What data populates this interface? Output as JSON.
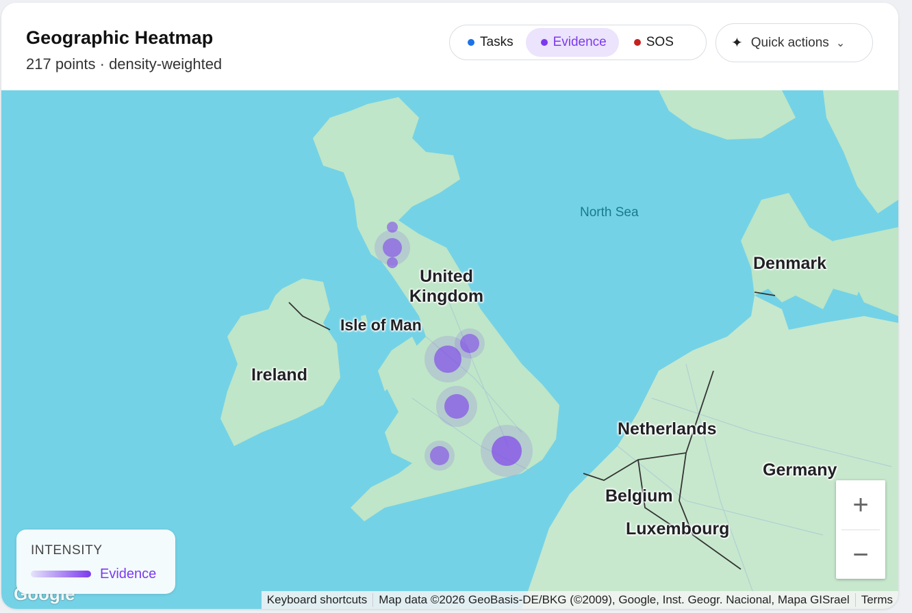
{
  "header": {
    "title": "Geographic Heatmap",
    "subtitle": "217 points · density-weighted"
  },
  "filters": [
    {
      "label": "Tasks",
      "color": "#1a73e8",
      "active": false
    },
    {
      "label": "Evidence",
      "color": "#7c3aed",
      "active": true
    },
    {
      "label": "SOS",
      "color": "#c5221f",
      "active": false
    }
  ],
  "quick_actions": {
    "label": "Quick actions",
    "icon": "sparkle-icon"
  },
  "map": {
    "countries": [
      "United Kingdom",
      "Ireland",
      "Isle of Man",
      "Denmark",
      "Netherlands",
      "Germany",
      "Belgium",
      "Luxembourg"
    ],
    "seas": [
      "North Sea"
    ],
    "zoom_in": "+",
    "zoom_out": "−",
    "google_logo": "Google",
    "attribution": {
      "shortcuts": "Keyboard shortcuts",
      "data": "Map data ©2026 GeoBasis-DE/BKG (©2009), Google, Inst. Geogr. Nacional, Mapa GISrael",
      "terms": "Terms"
    }
  },
  "legend": {
    "title": "INTENSITY",
    "series": "Evidence",
    "color": "#7c3aed"
  }
}
